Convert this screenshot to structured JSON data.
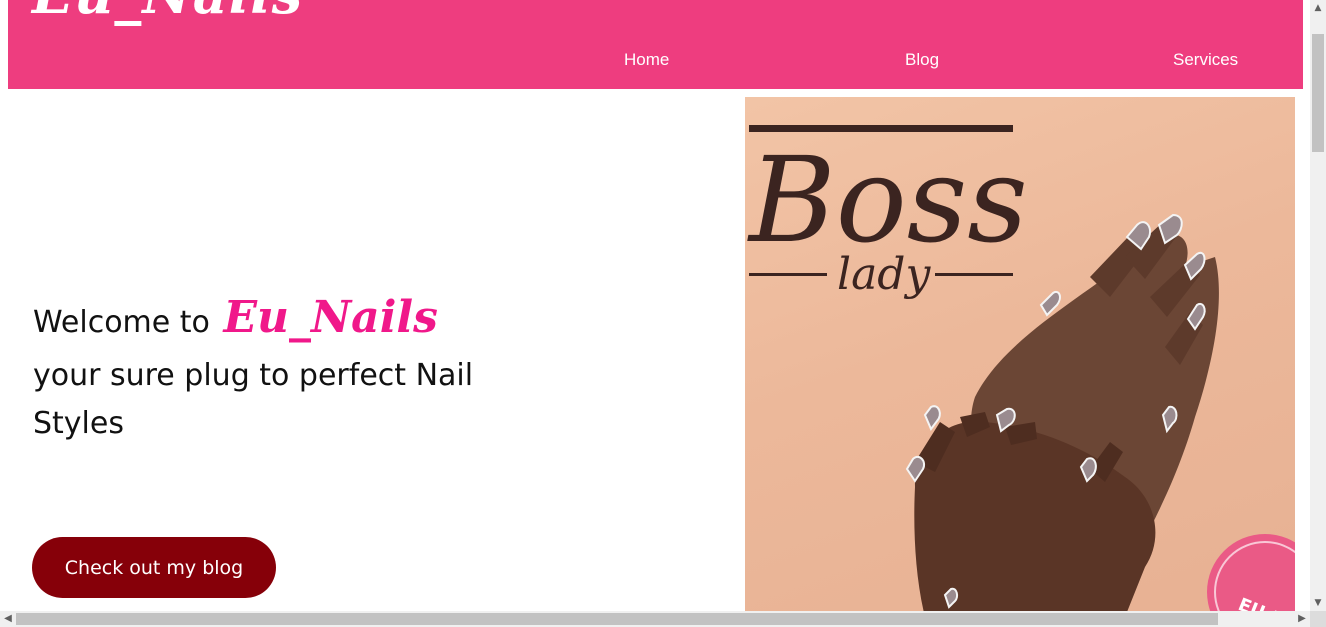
{
  "header": {
    "logo": "Eu_Nails",
    "nav": [
      {
        "label": "Home"
      },
      {
        "label": "Blog"
      },
      {
        "label": "Services"
      }
    ],
    "background_color": "#ee3d7f"
  },
  "hero": {
    "welcome_prefix": "Welcome to",
    "brand": "Eu_Nails",
    "tagline": "your sure plug to perfect Nail Styles",
    "cta_label": "Check out my blog",
    "brand_color": "#f0188a",
    "cta_color": "#860009"
  },
  "image": {
    "headline": "Boss",
    "subline": "lady",
    "badge": "EU-NA"
  },
  "scrollbars": {
    "up": "▲",
    "down": "▼",
    "left": "◀",
    "right": "▶"
  }
}
